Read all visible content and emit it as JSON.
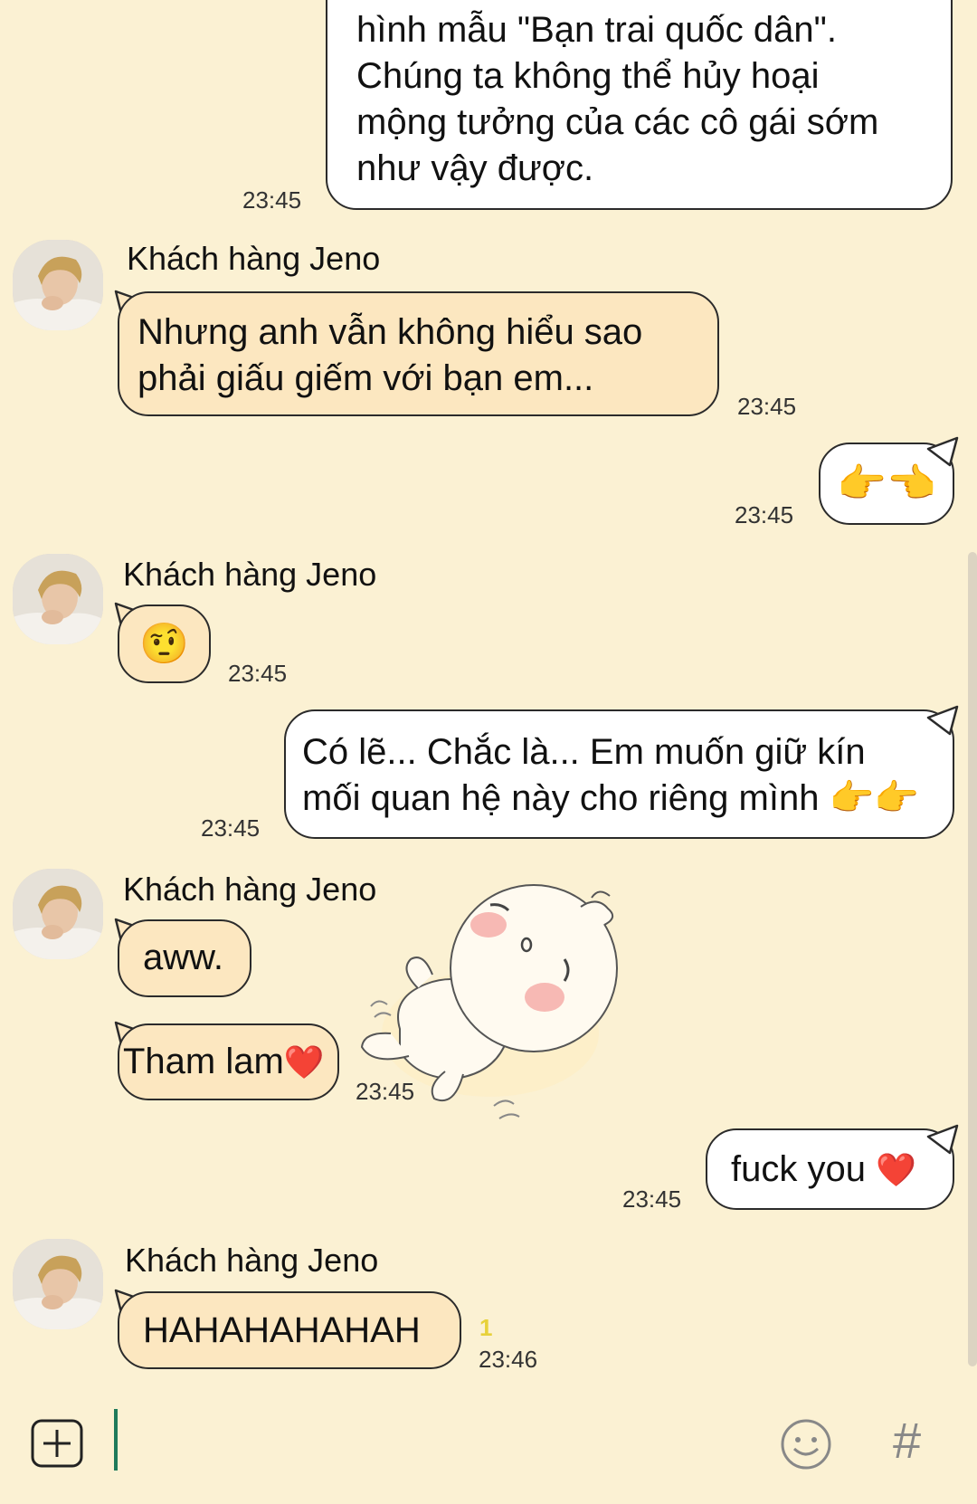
{
  "messages": [
    {
      "id": "m1",
      "dir": "out",
      "text_lines": [
        "hình mẫu \"Bạn trai quốc dân\".",
        "Chúng ta không thể hủy hoại",
        "mộng tưởng của các cô gái sớm",
        "như vậy được."
      ],
      "time": "23:45"
    },
    {
      "id": "m2",
      "dir": "in",
      "sender": "Khách hàng Jeno",
      "text_lines": [
        "Nhưng anh vẫn không hiểu sao",
        "phải giấu giếm với bạn em..."
      ],
      "time": "23:45"
    },
    {
      "id": "m3",
      "dir": "out",
      "emoji": "👉👈",
      "time": "23:45"
    },
    {
      "id": "m4",
      "dir": "in",
      "sender": "Khách hàng Jeno",
      "emoji": "🤨",
      "time": "23:45"
    },
    {
      "id": "m5",
      "dir": "out",
      "text_lines": [
        "Có lẽ... Chắc là... Em muốn giữ kín",
        "mối quan hệ này cho riêng mình 👉👉"
      ],
      "time": "23:45"
    },
    {
      "id": "m6",
      "dir": "in",
      "sender": "Khách hàng Jeno",
      "text": "aww."
    },
    {
      "id": "m7",
      "dir": "in",
      "text": "Tham lam",
      "emoji": "❤️",
      "time": "23:45",
      "sticker": "sleeping-baby-sticker"
    },
    {
      "id": "m8",
      "dir": "out",
      "text": "fuck you",
      "emoji": "❤️",
      "time": "23:45"
    },
    {
      "id": "m9",
      "dir": "in",
      "sender": "Khách hàng Jeno",
      "text": "HAHAHAHAHAH",
      "unread": "1",
      "time": "23:46"
    }
  ],
  "composer": {
    "add_icon": "plus-square-icon",
    "emoji_icon": "smiley-icon",
    "hash_label": "#"
  },
  "colors": {
    "background": "#fbf1d3",
    "incoming_bubble": "#fce7c0",
    "outgoing_bubble": "#ffffff",
    "cursor": "#1e7a5a",
    "unread": "#e7d13a"
  }
}
